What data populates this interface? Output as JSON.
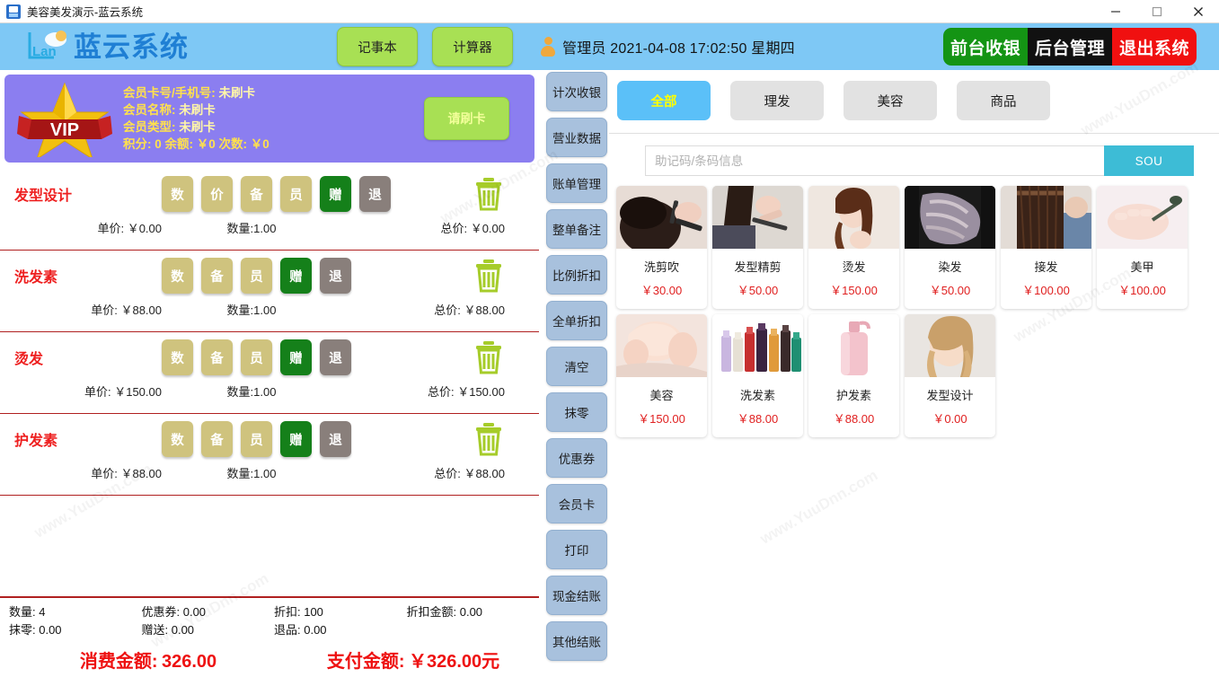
{
  "window": {
    "title": "美容美发演示-蓝云系统",
    "app_icon": "app-icon",
    "minimize": "—",
    "maximize": "□",
    "close": "✕"
  },
  "header": {
    "logo_text": "蓝云系统",
    "buttons": [
      {
        "label": "记事本",
        "name": "notepad-button"
      },
      {
        "label": "计算器",
        "name": "calculator-button"
      }
    ],
    "user": {
      "role": "管理员",
      "date": "2021-04-08",
      "time": "17:02:50",
      "weekday": "星期四",
      "full": "管理员 2021-04-08  17:02:50  星期四"
    },
    "right_buttons": [
      {
        "label": "前台收银",
        "name": "front-cashier-button",
        "color": "#149414"
      },
      {
        "label": "后台管理",
        "name": "backend-admin-button",
        "color": "#111111"
      },
      {
        "label": "退出系统",
        "name": "exit-system-button",
        "color": "#f01010"
      }
    ]
  },
  "member_card": {
    "line1_label": "会员卡号/手机号:",
    "line1_value": "未刷卡",
    "line2_label": "会员名称:",
    "line2_value": "未刷卡",
    "line3_label": "会员类型:",
    "line3_value": "未刷卡",
    "line4": "积分: 0 余额: ￥0 次数: ￥0",
    "swipe_button": "请刷卡",
    "badge_text": "VIP"
  },
  "order_items": [
    {
      "name": "发型设计",
      "buttons": [
        "数",
        "价",
        "备",
        "员",
        "赠",
        "退"
      ],
      "unit_price_label": "单价:",
      "unit_price": "￥0.00",
      "qty_label": "数量:1.00",
      "total_label": "总价:",
      "total": "￥0.00"
    },
    {
      "name": "洗发素",
      "buttons": [
        "数",
        "备",
        "员",
        "赠",
        "退"
      ],
      "unit_price_label": "单价:",
      "unit_price": "￥88.00",
      "qty_label": "数量:1.00",
      "total_label": "总价:",
      "total": "￥88.00"
    },
    {
      "name": "烫发",
      "buttons": [
        "数",
        "备",
        "员",
        "赠",
        "退"
      ],
      "unit_price_label": "单价:",
      "unit_price": "￥150.00",
      "qty_label": "数量:1.00",
      "total_label": "总价:",
      "total": "￥150.00"
    },
    {
      "name": "护发素",
      "buttons": [
        "数",
        "备",
        "员",
        "赠",
        "退"
      ],
      "unit_price_label": "单价:",
      "unit_price": "￥88.00",
      "qty_label": "数量:1.00",
      "total_label": "总价:",
      "total": "￥88.00"
    }
  ],
  "summary": {
    "qty": "数量: 4",
    "coupon": "优惠券: 0.00",
    "discount": "折扣: 100",
    "discount_amount": "折扣金额: 0.00",
    "round_off": "抹零: 0.00",
    "gift": "赠送: 0.00",
    "refund": "退品: 0.00",
    "consume_label": "消费金额:",
    "consume_value": "326.00",
    "pay_label": "支付金额:",
    "pay_value": "￥326.00元"
  },
  "side_buttons": [
    {
      "label": "计次收银",
      "name": "side-button-count-cashier"
    },
    {
      "label": "营业数据",
      "name": "side-button-business-data"
    },
    {
      "label": "账单管理",
      "name": "side-button-bill-management"
    },
    {
      "label": "整单备注",
      "name": "side-button-order-remark"
    },
    {
      "label": "比例折扣",
      "name": "side-button-ratio-discount"
    },
    {
      "label": "全单折扣",
      "name": "side-button-full-discount"
    },
    {
      "label": "清空",
      "name": "side-button-clear"
    },
    {
      "label": "抹零",
      "name": "side-button-round-off"
    },
    {
      "label": "优惠券",
      "name": "side-button-coupon"
    },
    {
      "label": "会员卡",
      "name": "side-button-member-card"
    },
    {
      "label": "打印",
      "name": "side-button-print"
    },
    {
      "label": "现金结账",
      "name": "side-button-cash-checkout"
    },
    {
      "label": "其他结账",
      "name": "side-button-other-checkout"
    }
  ],
  "category_tabs": [
    {
      "label": "全部",
      "active": true
    },
    {
      "label": "理发",
      "active": false
    },
    {
      "label": "美容",
      "active": false
    },
    {
      "label": "商品",
      "active": false
    }
  ],
  "search": {
    "placeholder": "助记码/条码信息",
    "value": "",
    "button": "SOU"
  },
  "products": [
    {
      "name": "洗剪吹",
      "price": "￥30.00",
      "image": "haircut-wash-blow"
    },
    {
      "name": "发型精剪",
      "price": "￥50.00",
      "image": "precision-cut"
    },
    {
      "name": "烫发",
      "price": "￥150.00",
      "image": "perm"
    },
    {
      "name": "染发",
      "price": "￥50.00",
      "image": "hair-dye"
    },
    {
      "name": "接发",
      "price": "￥100.00",
      "image": "hair-extension"
    },
    {
      "name": "美甲",
      "price": "￥100.00",
      "image": "manicure"
    },
    {
      "name": "美容",
      "price": "￥150.00",
      "image": "facial-beauty"
    },
    {
      "name": "洗发素",
      "price": "￥88.00",
      "image": "shampoo-bottles"
    },
    {
      "name": "护发素",
      "price": "￥88.00",
      "image": "conditioner-bottle"
    },
    {
      "name": "发型设计",
      "price": "￥0.00",
      "image": "hair-styling"
    }
  ],
  "watermark": "www.YuuDnn.com",
  "colors": {
    "header_blue": "#7ec8f5",
    "accent_green": "#a8e054",
    "member_purple": "#8b7ef0",
    "price_red": "#e02020",
    "tab_active": "#5bc0f8",
    "search_button": "#3dbcd6",
    "side_button": "#a8c1dd"
  }
}
